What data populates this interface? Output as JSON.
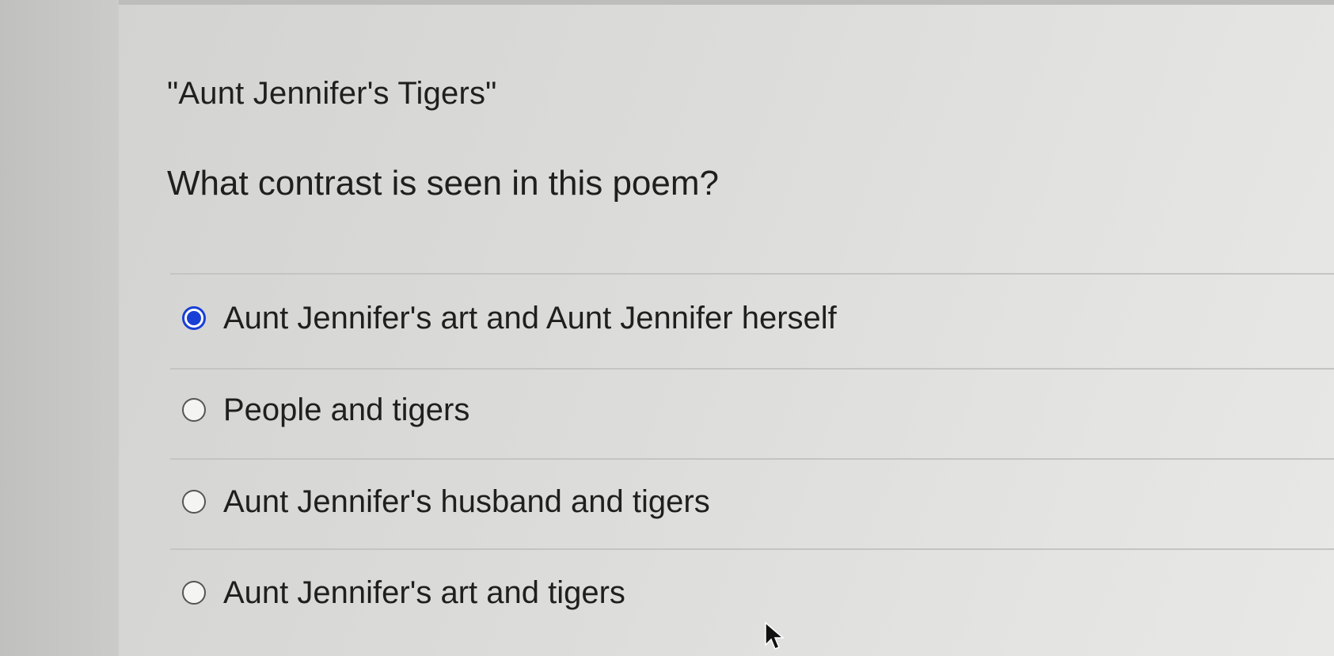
{
  "quiz": {
    "title": "\"Aunt Jennifer's Tigers\"",
    "question": "What contrast is seen in this poem?",
    "options": [
      {
        "label": "Aunt Jennifer's art and Aunt Jennifer herself",
        "selected": true
      },
      {
        "label": "People and tigers",
        "selected": false
      },
      {
        "label": "Aunt Jennifer's husband and tigers",
        "selected": false
      },
      {
        "label": "Aunt Jennifer's art and tigers",
        "selected": false
      }
    ],
    "selected_index": 0
  },
  "colors": {
    "accent": "#1a3fd6",
    "text": "#1f1f1f",
    "divider": "#c4c4c2"
  },
  "icons": {
    "selected_radio": "radio-selected-icon",
    "unselected_radio": "radio-unselected-icon",
    "cursor": "mouse-pointer-icon"
  }
}
